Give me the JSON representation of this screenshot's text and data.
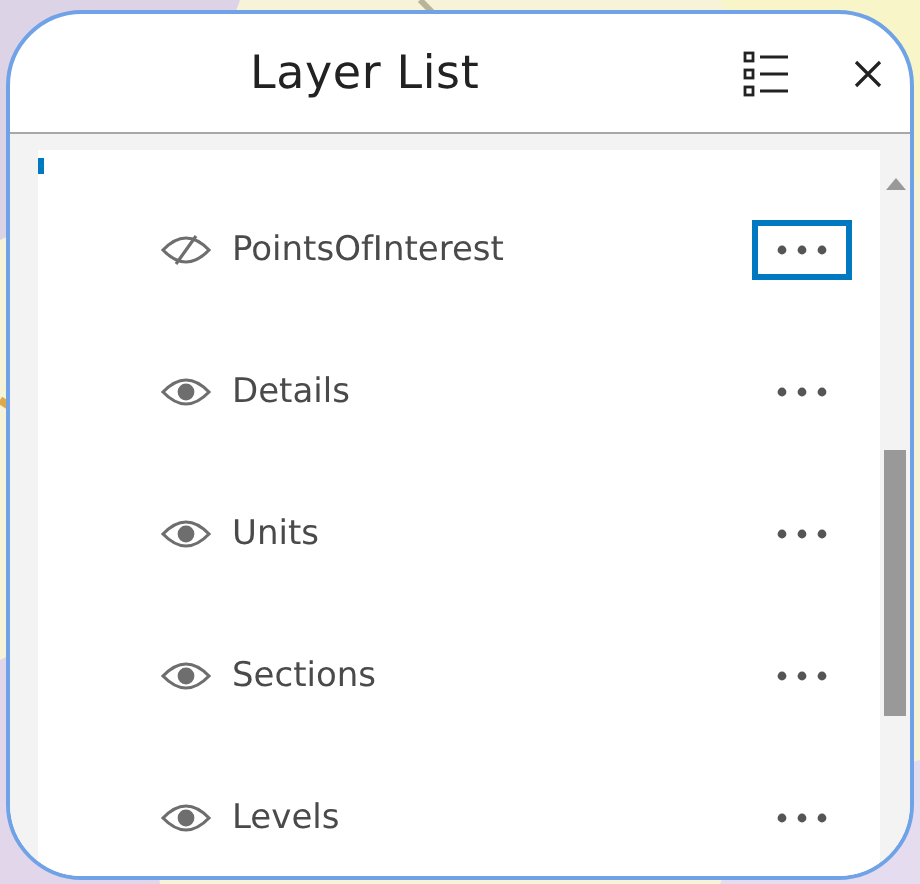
{
  "panel": {
    "title": "Layer List"
  },
  "layers": [
    {
      "label": "PointsOfInterest",
      "visible": false,
      "focused": true
    },
    {
      "label": "Details",
      "visible": true,
      "focused": false
    },
    {
      "label": "Units",
      "visible": true,
      "focused": false
    },
    {
      "label": "Sections",
      "visible": true,
      "focused": false
    },
    {
      "label": "Levels",
      "visible": true,
      "focused": false
    }
  ]
}
